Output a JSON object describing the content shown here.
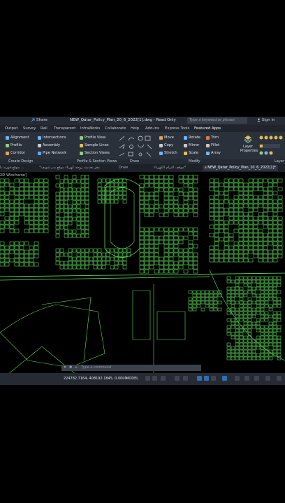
{
  "titlebar": {
    "share_label": "Share",
    "document_title": "NEW_Qatar_Policy_Plan_20_6_2022[1].dwg - Read Only",
    "search_placeholder": "Type a keyword or phrase",
    "signin_label": "Sign In"
  },
  "menu": {
    "items": [
      "Output",
      "Survey",
      "Rail",
      "Transparent",
      "InfraWorks",
      "Collaborate",
      "Help",
      "Add-ins",
      "Express Tools",
      "Featured Apps"
    ]
  },
  "ribbon": {
    "design": [
      "Alignment",
      "Profile",
      "Corridor"
    ],
    "create": [
      "Intersections",
      "Assembly",
      "Pipe Network"
    ],
    "views": [
      "Profile View",
      "Sample Lines",
      "Section Views"
    ],
    "modify": [
      "Move",
      "Copy",
      "Stretch",
      "Rotate",
      "Mirror",
      "Scale",
      "Trim",
      "Fillet",
      "Array"
    ],
    "layer": [
      "Layer",
      "Properties"
    ],
    "panels": [
      "Create Design",
      "Profile & Section Views",
      "Draw",
      "Modify",
      "Layer"
    ]
  },
  "tabs": [
    "موقع فورتد با ...",
    "*مقر تحديث زوجة كهرباء موقع بدر شوبف",
    "Draw",
    "موقف الترام الكهرباء*",
    "NEW_Qatar_Policy_Plan_20_6_2022[1]*"
  ],
  "viewport": {
    "label": "2D Wireframe]"
  },
  "command": {
    "placeholder": "Type a command"
  },
  "status": {
    "coords": "224782.7164, 408192.1845, 0.0000",
    "model": "MODEL"
  },
  "colors": {
    "drawing_lines": "#5fe05a",
    "background": "#000000",
    "ribbon_bg": "#2b313b"
  }
}
